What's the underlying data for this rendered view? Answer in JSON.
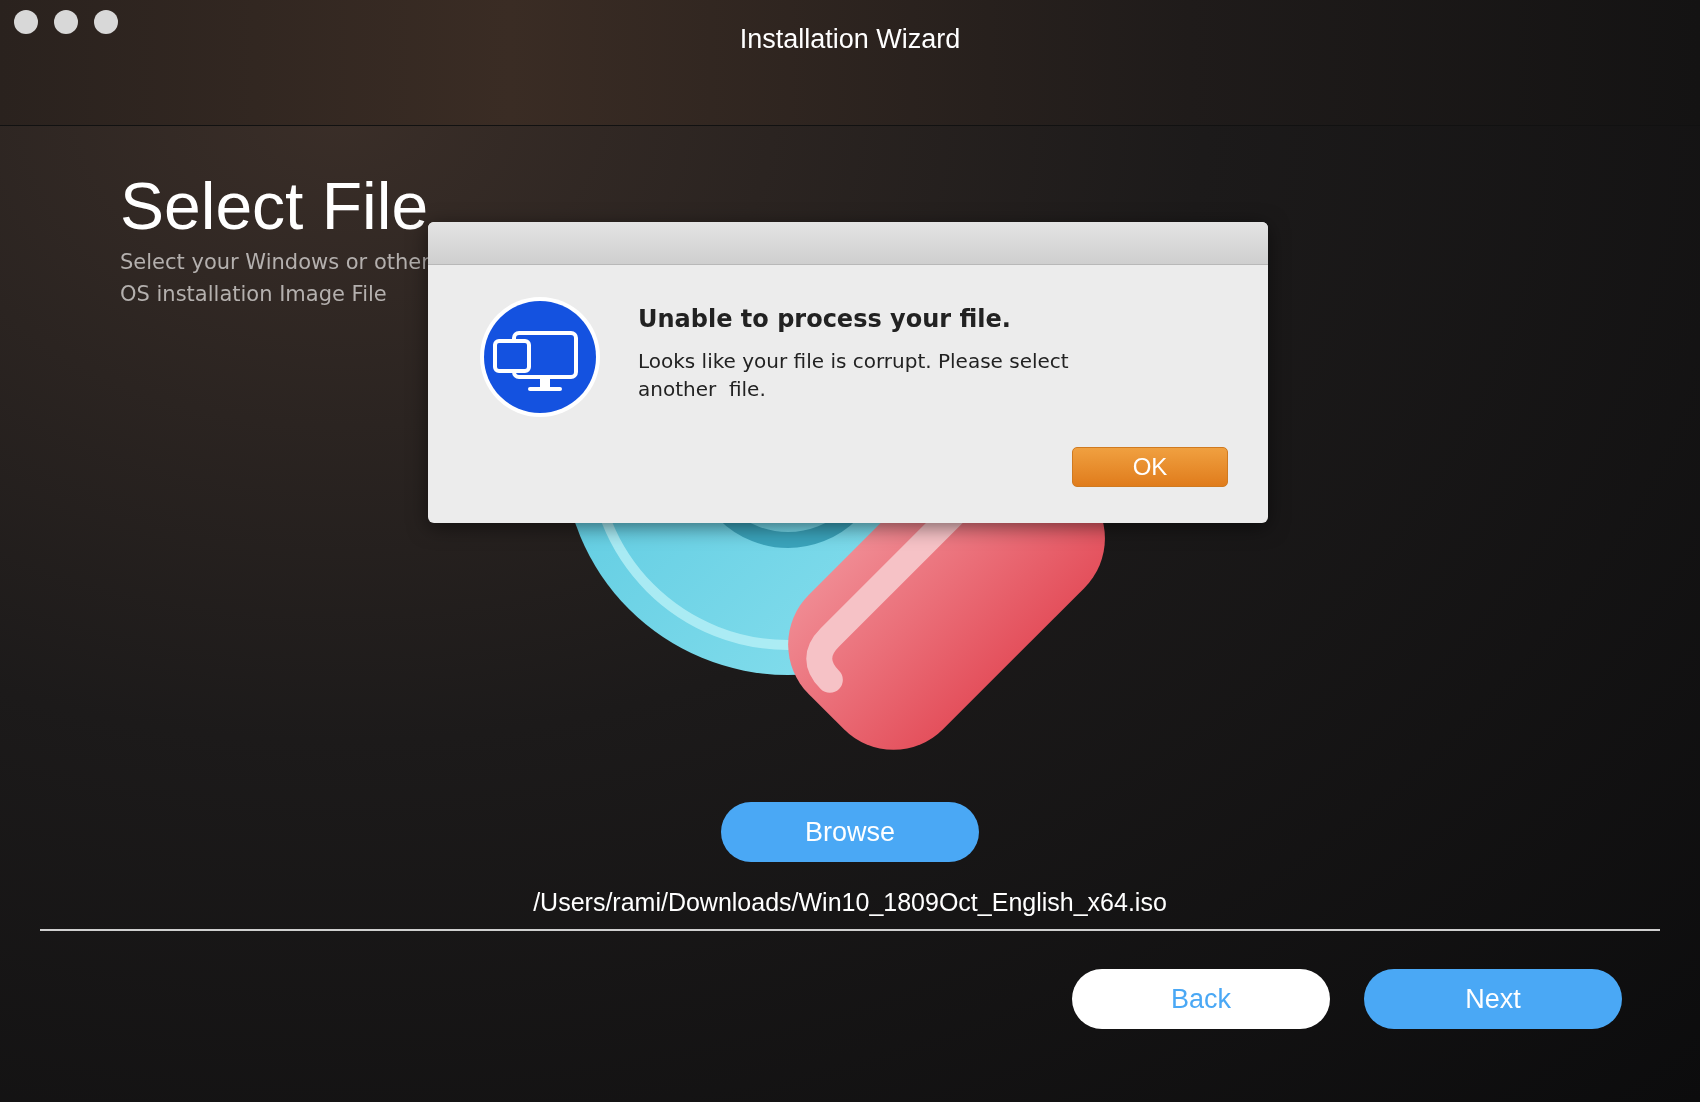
{
  "window": {
    "title": "Installation Wizard"
  },
  "heading": {
    "title": "Select File",
    "subtitle": "Select your Windows or other OS installation Image File"
  },
  "dialog": {
    "title": "Unable to process your file.",
    "message": "Looks like your file is corrupt. Please select another  file.",
    "ok_button": "OK"
  },
  "browse_button": "Browse",
  "file_path": "/Users/rami/Downloads/Win10_1809Oct_English_x64.iso",
  "footer": {
    "back_button": "Back",
    "next_button": "Next"
  }
}
